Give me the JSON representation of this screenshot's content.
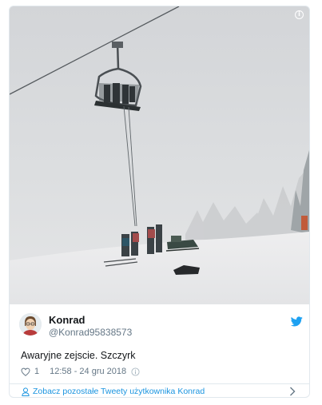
{
  "tweet": {
    "author_name": "Konrad",
    "author_handle": "@Konrad95838573",
    "text": "Awaryjne zejscie. Szczyrk",
    "like_count": "1",
    "timestamp": "12:58 - 24 gru 2018",
    "more_tweets_link": "Zobacz pozostałe Tweety użytkownika Konrad"
  },
  "colors": {
    "link": "#1b95e0",
    "secondary_text": "#657786",
    "border": "#e1e8ed",
    "twitter_brand": "#1da1f2"
  },
  "icons": {
    "brand": "twitter-bird-icon",
    "like": "heart-icon",
    "info": "info-icon",
    "more": "chevron-right-icon",
    "profile": "person-icon"
  }
}
